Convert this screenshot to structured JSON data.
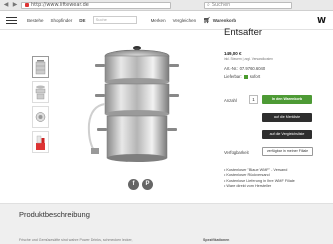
{
  "browser": {
    "back": "◀",
    "forward": "▶",
    "url": "http://www.liftewear.de",
    "search_placeholder": "Suchen"
  },
  "header": {
    "links": [
      "Bestehe",
      "Shopfinder",
      "DE"
    ],
    "search_placeholder": "Suche",
    "links_right": [
      "Merken",
      "Vergleichen"
    ],
    "cart_label": "Warenkorb",
    "logo": "W"
  },
  "product": {
    "title": "Entsafter",
    "price": "149,00 €",
    "price_note": "inkl. Steuern | zzgl. Versandkosten",
    "article_number": "Art.-Nr.: 07.9760.6040",
    "delivery_label": "Lieferbar:",
    "delivery_status": "sofort",
    "quantity_label": "Anzahl",
    "quantity_value": "1",
    "add_to_cart": "In den Warenkorb",
    "add_to_wishlist": "auf die Merkliste",
    "add_to_compare": "auf die Vergleichsliste",
    "availability_label": "Verfügbarkeit",
    "availability_button": "verfügbar in meiner Filiale",
    "features": [
      "Kostenloser \"Blaue WMF\" - Versand",
      "Kostenloser Rückversand",
      "Kostenlose Lieferung in Ihre WMF Filiale",
      "Ware direkt vom Hersteller"
    ]
  },
  "social": {
    "facebook": "f",
    "pinterest": "P"
  },
  "description": {
    "title": "Produktbeschreibung",
    "text": "Frische und Gemüsesäfte sind wahre Power Drinks, schmecken lecker,",
    "spec_label": "Spezifikationen"
  },
  "colors": {
    "accent_green": "#4d9a35",
    "dark_button": "#2e2e2e"
  }
}
